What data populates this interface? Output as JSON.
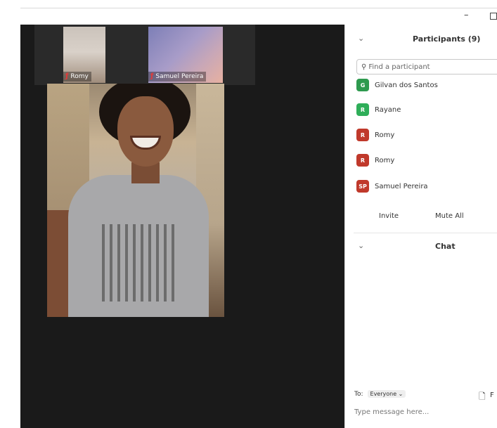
{
  "window": {
    "minimize_glyph": "–"
  },
  "thumbnails": [
    {
      "name": "Romy",
      "muted": true
    },
    {
      "name": "Samuel Pereira",
      "muted": true
    }
  ],
  "panel": {
    "title": "Participants (9)",
    "search_placeholder": "Find a participant",
    "participants": [
      {
        "initials": "G",
        "name": "Gilvan dos Santos",
        "color": "#2e9a4f"
      },
      {
        "initials": "R",
        "name": "Rayane",
        "color": "#2fae59"
      },
      {
        "initials": "R",
        "name": "Romy",
        "color": "#c0392b"
      },
      {
        "initials": "R",
        "name": "Romy",
        "color": "#c0392b"
      },
      {
        "initials": "SP",
        "name": "Samuel Pereira",
        "color": "#c0392b"
      }
    ],
    "invite_label": "Invite",
    "mute_all_label": "Mute All"
  },
  "chat": {
    "title": "Chat",
    "to_label": "To:",
    "recipient": "Everyone",
    "file_label": "F",
    "input_placeholder": "Type message here..."
  },
  "colors": {
    "muted_mic": "#e23a3a",
    "video_bg": "#1a1a1a"
  }
}
